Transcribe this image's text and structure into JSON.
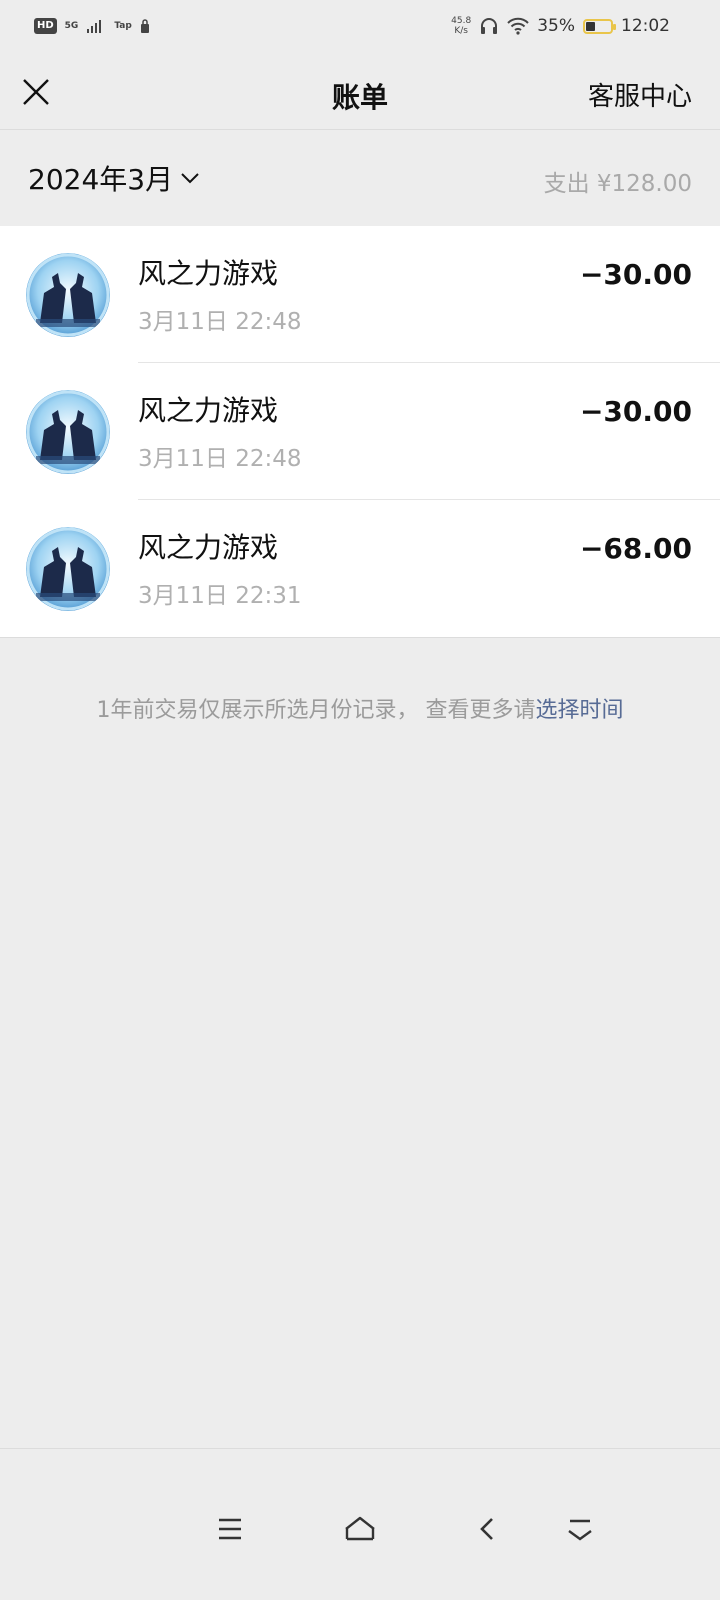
{
  "status_bar": {
    "hd": "HD",
    "network": "5G",
    "app_badge": "Tap",
    "net_speed_value": "45.8",
    "net_speed_unit": "K/s",
    "battery": "35%",
    "time": "12:02"
  },
  "nav": {
    "title": "账单",
    "service_link": "客服中心",
    "close_icon": "close-icon"
  },
  "filter": {
    "month": "2024年3月",
    "total": "支出 ¥128.00"
  },
  "transactions": [
    {
      "name": "风之力游戏",
      "time": "3月11日 22:48",
      "amount": "−30.00"
    },
    {
      "name": "风之力游戏",
      "time": "3月11日 22:48",
      "amount": "−30.00"
    },
    {
      "name": "风之力游戏",
      "time": "3月11日 22:31",
      "amount": "−68.00"
    }
  ],
  "notice": {
    "text": "1年前交易仅展示所选月份记录， 查看更多请",
    "link": "选择时间"
  },
  "system_nav": {
    "icons": [
      "menu-icon",
      "home-icon",
      "back-icon",
      "collapse-icon"
    ]
  },
  "colors": {
    "background": "#ededed",
    "link": "#576b95",
    "secondary_text": "#a9a9a9"
  }
}
